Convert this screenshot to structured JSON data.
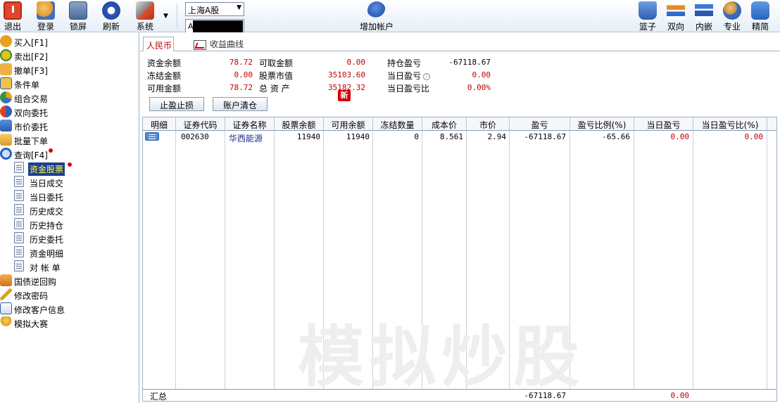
{
  "toolbar": {
    "exit": "退出",
    "login": "登录",
    "lock": "锁屏",
    "refresh": "刷新",
    "system": "系统",
    "market": "上海A股",
    "account_prefix": "A",
    "add_account": "增加帐户",
    "basket": "篮子",
    "dual": "双向",
    "embed": "内嵌",
    "pro": "专业",
    "simple": "精简"
  },
  "sidebar": {
    "items": [
      {
        "label": "买入[F1]",
        "icon": "buy-icon"
      },
      {
        "label": "卖出[F2]",
        "icon": "sell-icon"
      },
      {
        "label": "撤单[F3]",
        "icon": "cancel-order-icon"
      },
      {
        "label": "条件单",
        "icon": "condition-order-icon"
      },
      {
        "label": "组合交易",
        "icon": "combo-trade-icon"
      },
      {
        "label": "双向委托",
        "icon": "dual-order-icon"
      },
      {
        "label": "市价委托",
        "icon": "market-order-icon"
      },
      {
        "label": "批量下单",
        "icon": "batch-order-icon"
      },
      {
        "label": "查询[F4]",
        "icon": "query-icon"
      }
    ],
    "query_children": [
      "资金股票",
      "当日成交",
      "当日委托",
      "历史成交",
      "历史持仓",
      "历史委托",
      "资金明细",
      "对 帐 单"
    ],
    "bottom_items": [
      {
        "label": "国债逆回购",
        "icon": "bond-repo-icon"
      },
      {
        "label": "修改密码",
        "icon": "key-icon"
      },
      {
        "label": "修改客户信息",
        "icon": "user-info-icon"
      },
      {
        "label": "模拟大赛",
        "icon": "trophy-icon"
      }
    ]
  },
  "tabs": {
    "rmb": "人民币",
    "curve": "收益曲线"
  },
  "summary": {
    "cash_balance_label": "资金余额",
    "cash_balance": "78.72",
    "frozen_label": "冻结金额",
    "frozen": "0.00",
    "available_label": "可用金额",
    "available": "78.72",
    "withdrawable_label": "可取金额",
    "withdrawable": "0.00",
    "stock_value_label": "股票市值",
    "stock_value": "35103.60",
    "total_assets_label": "总 资 产",
    "total_assets": "35182.32",
    "position_pl_label": "持仓盈亏",
    "position_pl": "-67118.67",
    "today_pl_label": "当日盈亏",
    "today_pl": "0.00",
    "today_pl_ratio_label": "当日盈亏比",
    "today_pl_ratio": "0.00%"
  },
  "buttons": {
    "stop": "止盈止损",
    "new_badge": "新",
    "clear": "账户清仓"
  },
  "table": {
    "headers": [
      "明细",
      "证券代码",
      "证券名称",
      "股票余额",
      "可用余额",
      "冻结数量",
      "成本价",
      "市价",
      "盈亏",
      "盈亏比例(%)",
      "当日盈亏",
      "当日盈亏比(%)"
    ],
    "rows": [
      {
        "code": "002630",
        "name": "华西能源",
        "balance": "11940",
        "available": "11940",
        "frozen": "0",
        "cost": "8.561",
        "price": "2.94",
        "pl": "-67118.67",
        "pl_ratio": "-65.66",
        "today_pl": "0.00",
        "today_pl_ratio": "0.00"
      }
    ],
    "total_label": "汇总",
    "total_pl": "-67118.67",
    "total_today_pl": "0.00"
  },
  "watermark": "模拟炒股"
}
